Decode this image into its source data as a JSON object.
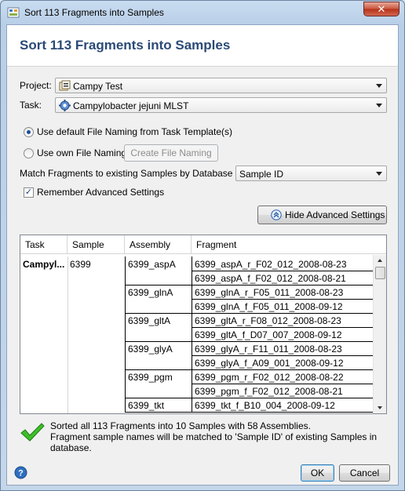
{
  "window": {
    "title": "Sort 113 Fragments into Samples",
    "close_label": "✕"
  },
  "header": {
    "title": "Sort 113 Fragments into Samples"
  },
  "project": {
    "label": "Project:",
    "value": "Campy Test"
  },
  "task": {
    "label": "Task:",
    "value": "Campylobacter jejuni MLST"
  },
  "naming": {
    "default_label": "Use default File Naming from Task Template(s)",
    "own_label": "Use own File Naming:",
    "create_button": "Create File Naming",
    "selected": "default"
  },
  "match": {
    "label": "Match Fragments to existing Samples by Database Field:",
    "value": "Sample ID"
  },
  "remember": {
    "label": "Remember Advanced Settings",
    "checked": true
  },
  "advanced_button": "Hide Advanced Settings",
  "table": {
    "headers": [
      "Task",
      "Sample",
      "Assembly",
      "Fragment"
    ],
    "task": "Campyl...",
    "sample": "6399",
    "assemblies": [
      {
        "name": "6399_aspA",
        "fragments": [
          "6399_aspA_r_F02_012_2008-08-23",
          "6399_aspA_f_F02_012_2008-08-21"
        ]
      },
      {
        "name": "6399_glnA",
        "fragments": [
          "6399_glnA_r_F05_011_2008-08-23",
          "6399_glnA_f_F05_011_2008-09-12"
        ]
      },
      {
        "name": "6399_gltA",
        "fragments": [
          "6399_gltA_r_F08_012_2008-08-23",
          "6399_gltA_f_D07_007_2008-09-12"
        ]
      },
      {
        "name": "6399_glyA",
        "fragments": [
          "6399_glyA_r_F11_011_2008-08-23",
          "6399_glyA_f_A09_001_2008-09-12"
        ]
      },
      {
        "name": "6399_pgm",
        "fragments": [
          "6399_pgm_r_F02_012_2008-08-22",
          "6399_pgm_f_F02_012_2008-08-21"
        ]
      },
      {
        "name": "6399_tkt",
        "fragments": [
          "6399_tkt_f_B10_004_2008-09-12"
        ]
      }
    ]
  },
  "status": {
    "line1": "Sorted all 113 Fragments into 10 Samples with 58 Assemblies.",
    "line2": "Fragment sample names will be matched to 'Sample ID' of existing Samples in database."
  },
  "buttons": {
    "ok": "OK",
    "cancel": "Cancel"
  },
  "icons": {
    "help": "help-icon",
    "status": "checkmark-icon"
  }
}
